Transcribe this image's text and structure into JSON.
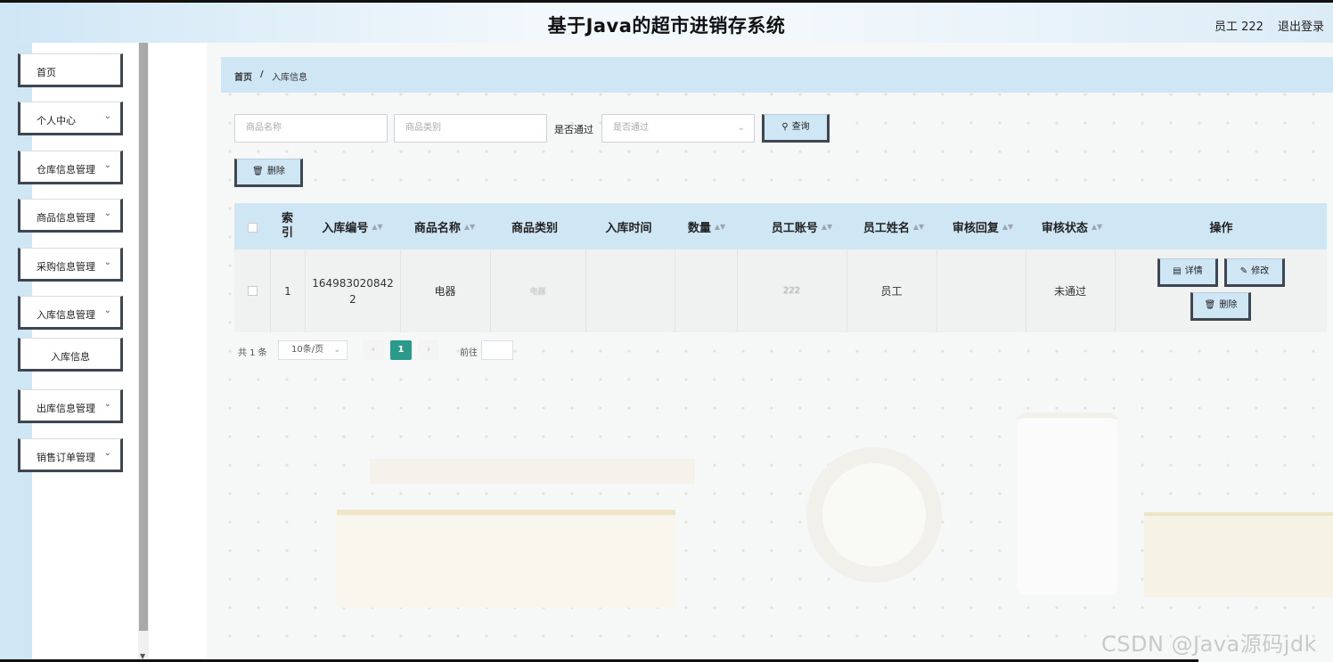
{
  "header": {
    "title": "基于Java的超市进销存系统",
    "user": "员工 222",
    "logout": "退出登录"
  },
  "sidebar": {
    "items": [
      {
        "label": "首页"
      },
      {
        "label": "个人中心"
      },
      {
        "label": "仓库信息管理"
      },
      {
        "label": "商品信息管理"
      },
      {
        "label": "采购信息管理"
      },
      {
        "label": "入库信息管理"
      },
      {
        "label": "入库信息"
      },
      {
        "label": "出库信息管理"
      },
      {
        "label": "销售订单管理"
      }
    ]
  },
  "breadcrumb": {
    "home": "首页",
    "separator": "/",
    "current": "入库信息"
  },
  "search": {
    "name_placeholder": "商品名称",
    "category_placeholder": "商品类别",
    "approved_label": "是否通过",
    "approved_placeholder": "是否通过",
    "query_button": "查询"
  },
  "toolbar": {
    "delete_button": "删除"
  },
  "table": {
    "headers": [
      "索引",
      "入库编号",
      "商品名称",
      "商品类别",
      "入库时间",
      "数量",
      "员工账号",
      "员工姓名",
      "审核回复",
      "审核状态",
      "操作"
    ],
    "rows": [
      {
        "index": "1",
        "number_line1": "164983020842",
        "number_line2": "2",
        "name": "电器",
        "category": "电器",
        "time": "",
        "quantity": "",
        "account": "222",
        "staff_name": "员工",
        "reply": "",
        "status": "未通过"
      }
    ],
    "actions": {
      "detail": "详情",
      "edit": "修改",
      "delete": "删除"
    }
  },
  "pagination": {
    "total": "共 1 条",
    "page_size": "10条/页",
    "prev": "‹",
    "current": "1",
    "next": "›",
    "goto": "前往"
  },
  "watermark": "CSDN @Java源码jdk",
  "colors": {
    "accent": "#cfe6f5",
    "border_dark": "#3e4652",
    "page_active": "#2a9a8a"
  }
}
